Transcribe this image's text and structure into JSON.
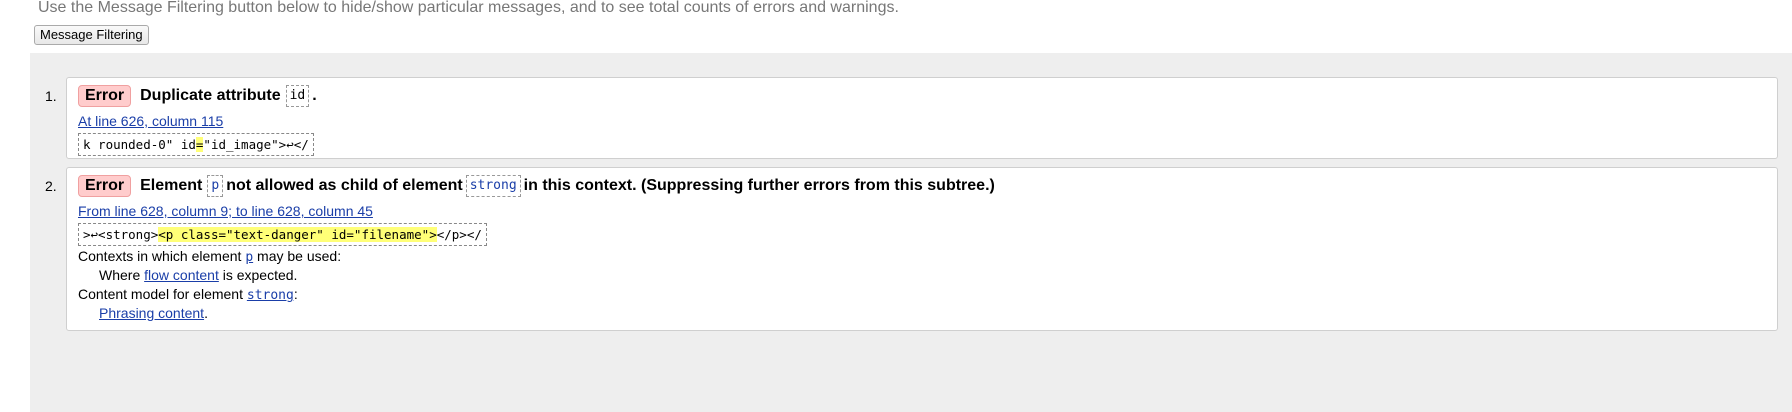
{
  "intro_text": "Use the Message Filtering button below to hide/show particular messages, and to see total counts of errors and warnings.",
  "filter_button_label": "Message Filtering",
  "messages": [
    {
      "number": "1.",
      "badge": "Error",
      "text_before": "Duplicate attribute",
      "code1": "id",
      "text_after": ".",
      "location": "At line 626, column 115",
      "extract_before": "k rounded-0\" id",
      "extract_hl": "=",
      "extract_after": "\"id_image\">↩</"
    },
    {
      "number": "2.",
      "badge": "Error",
      "text_a": "Element",
      "code1": "p",
      "text_b": "not allowed as child of element",
      "code2": "strong",
      "text_c": "in this context. (Suppressing further errors from this subtree.)",
      "location": "From line 628, column 9; to line 628, column 45",
      "extract_before": ">↩<strong>",
      "extract_hl": "<p class=\"text-danger\" id=\"filename\">",
      "extract_after": "</p></",
      "contexts_prefix": "Contexts in which element",
      "contexts_code": "p",
      "contexts_suffix": "may be used:",
      "where_prefix": "Where",
      "where_link": "flow content",
      "where_suffix": "is expected.",
      "model_prefix": "Content model for element",
      "model_code": "strong",
      "model_suffix": ":",
      "model_link": "Phrasing content",
      "model_end": "."
    }
  ]
}
